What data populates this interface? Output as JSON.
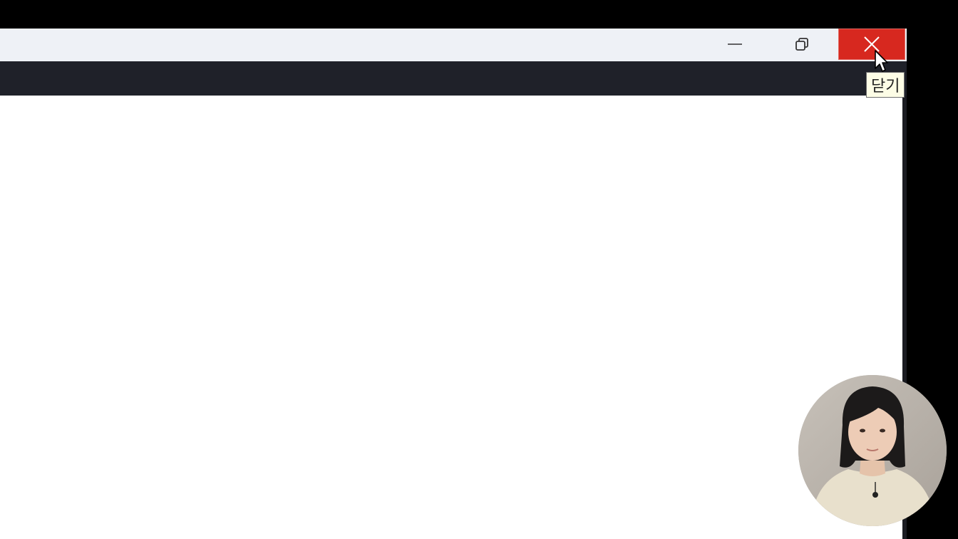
{
  "window": {
    "controls": {
      "minimize_icon": "minimize-icon",
      "restore_icon": "restore-icon",
      "close_icon": "close-icon"
    },
    "tooltip": {
      "text": "닫기"
    }
  },
  "colors": {
    "titlebar": "#eef1f6",
    "close_button": "#d7281f",
    "toolbar_band": "#1f2129",
    "background": "#000000",
    "tooltip_bg": "#fdfde6"
  },
  "overlay": {
    "webcam_icon": "presenter-webcam"
  }
}
